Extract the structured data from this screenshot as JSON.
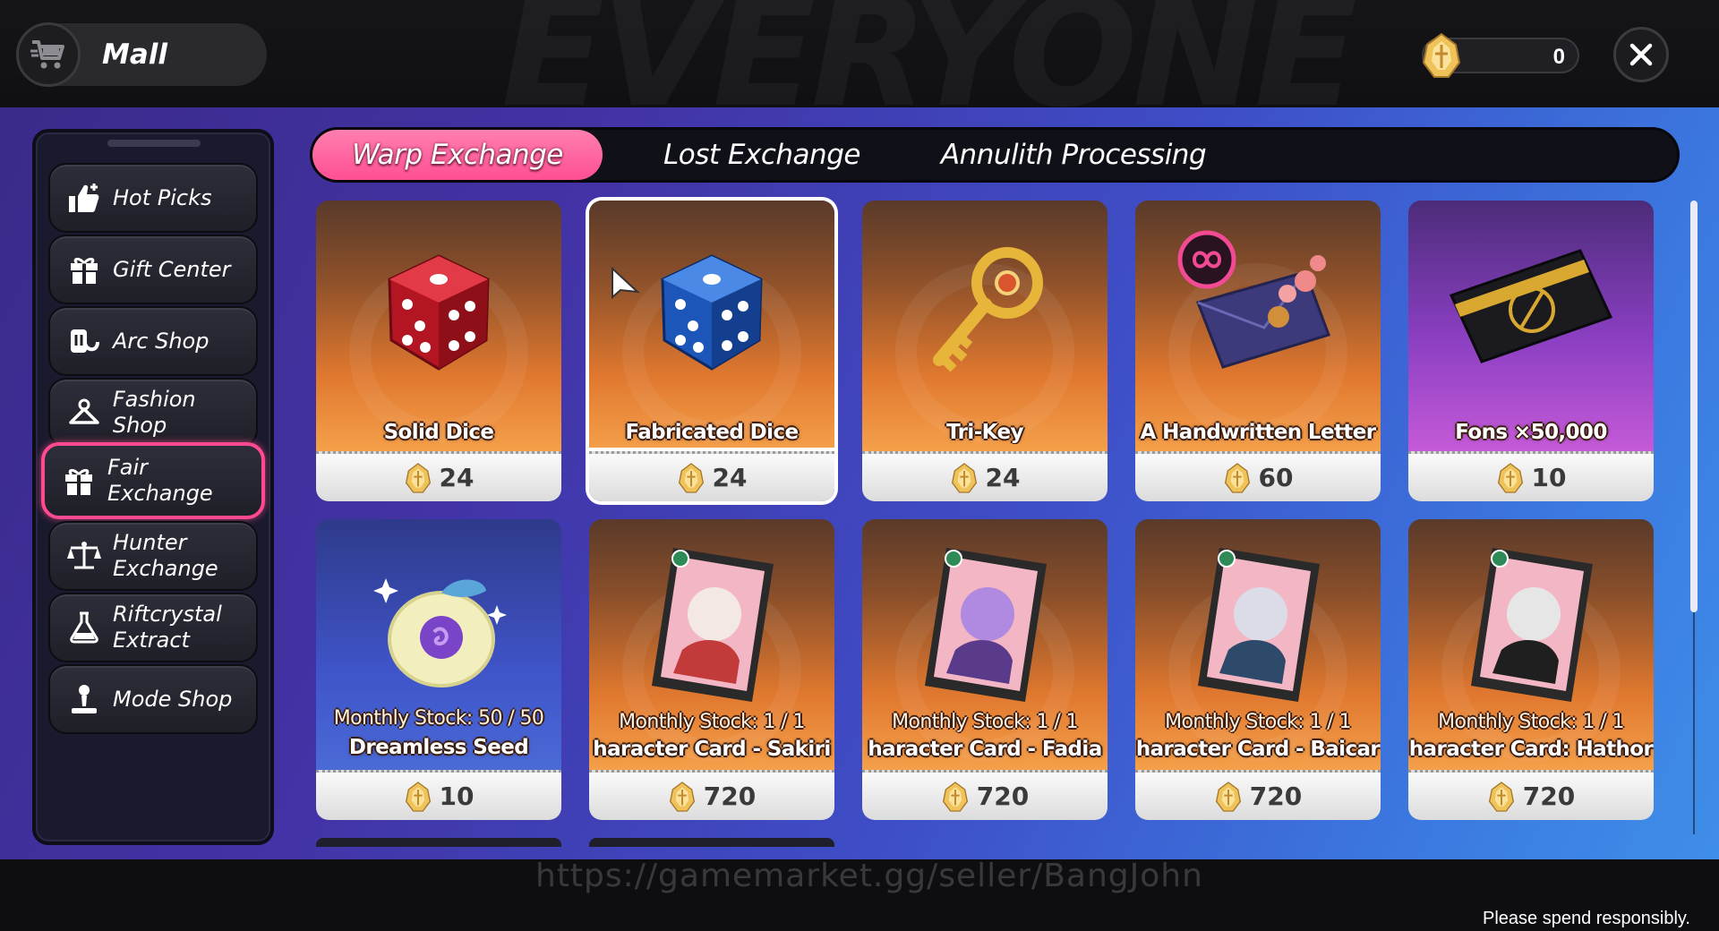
{
  "header": {
    "title": "Mall",
    "currency_amount": "0",
    "background_text": "EVERYONE"
  },
  "sidebar": {
    "items": [
      {
        "label_1": "Hot Picks",
        "label_2": "",
        "icon": "thumbs-up-icon"
      },
      {
        "label_1": "Gift Center",
        "label_2": "",
        "icon": "gift-icon"
      },
      {
        "label_1": "Arc Shop",
        "label_2": "",
        "icon": "arc-shop-icon"
      },
      {
        "label_1": "Fashion Shop",
        "label_2": "",
        "icon": "hanger-icon"
      },
      {
        "label_1": "Fair",
        "label_2": "Exchange",
        "icon": "gift-icon",
        "active": true
      },
      {
        "label_1": "Hunter",
        "label_2": "Exchange",
        "icon": "scales-icon"
      },
      {
        "label_1": "Riftcrystal",
        "label_2": "Extract",
        "icon": "flask-icon"
      },
      {
        "label_1": "Mode Shop",
        "label_2": "",
        "icon": "podium-icon"
      }
    ]
  },
  "tabs": [
    {
      "label": "Warp Exchange",
      "active": true
    },
    {
      "label": "Lost Exchange",
      "active": false
    },
    {
      "label": "Annulith Processing",
      "active": false
    }
  ],
  "items": [
    {
      "name": "Solid Dice",
      "price": "24",
      "stock": "",
      "art": "red-dice-icon"
    },
    {
      "name": "Fabricated Dice",
      "price": "24",
      "stock": "",
      "art": "blue-dice-icon",
      "selected": true
    },
    {
      "name": "Tri-Key",
      "price": "24",
      "stock": "",
      "art": "key-icon"
    },
    {
      "name": "A Handwritten Letter",
      "price": "60",
      "stock": "",
      "art": "letter-icon"
    },
    {
      "name": "Fons ×50,000",
      "price": "10",
      "stock": "",
      "art": "fons-card-icon"
    },
    {
      "name": "Dreamless Seed",
      "price": "10",
      "stock": "Monthly Stock:  50 / 50",
      "art": "seed-icon"
    },
    {
      "name": "haracter Card - Sakiri",
      "price": "720",
      "stock": "Monthly Stock:  1 / 1",
      "art": "character-card-icon"
    },
    {
      "name": "haracter Card - Fadia",
      "price": "720",
      "stock": "Monthly Stock:  1 / 1",
      "art": "character-card-icon"
    },
    {
      "name": "haracter Card - Baicar",
      "price": "720",
      "stock": "Monthly Stock:  1 / 1",
      "art": "character-card-icon"
    },
    {
      "name": "haracter Card: Hathor",
      "price": "720",
      "stock": "Monthly Stock:  1 / 1",
      "art": "character-card-icon"
    }
  ],
  "watermark": "https://gamemarket.gg/seller/BangJohn",
  "footer_note": "Please spend responsibly.",
  "colors": {
    "active_pink": "#ff4f93",
    "card_orange": "#e0782f",
    "panel_blue": "#3e4fc8",
    "coin_gold": "#f0c35a"
  }
}
